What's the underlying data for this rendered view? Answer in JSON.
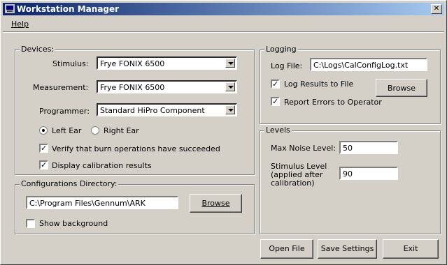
{
  "window": {
    "title": "Workstation Manager",
    "close_glyph": "✕"
  },
  "menu": {
    "help": "Help"
  },
  "devices": {
    "legend": "Devices:",
    "stimulus_label": "Stimulus:",
    "stimulus_value": "Frye FONIX 6500",
    "measurement_label": "Measurement:",
    "measurement_value": "Frye FONIX 6500",
    "programmer_label": "Programmer:",
    "programmer_value": "Standard HiPro Component",
    "left_ear": "Left Ear",
    "right_ear": "Right Ear",
    "selected_ear": "left",
    "verify_label": "Verify that burn operations have succeeded",
    "verify_checked": true,
    "display_label": "Display calibration results",
    "display_checked": true
  },
  "config_dir": {
    "legend": "Configurations Directory:",
    "path": "C:\\Program Files\\Gennum\\ARK",
    "browse": "Browse",
    "show_background": "Show background",
    "show_background_checked": false
  },
  "logging": {
    "legend": "Logging",
    "log_file_label": "Log File:",
    "log_file_value": "C:\\Logs\\CalConfigLog.txt",
    "log_results": "Log Results to File",
    "log_results_checked": true,
    "report_errors": "Report Errors to Operator",
    "report_errors_checked": true,
    "browse": "Browse"
  },
  "levels": {
    "legend": "Levels",
    "max_noise_label": "Max Noise Level:",
    "max_noise_value": "50",
    "stimulus_label_1": "Stimulus Level",
    "stimulus_label_2": "(applied after",
    "stimulus_label_3": "calibration)",
    "stimulus_value": "90"
  },
  "buttons": {
    "open_file": "Open File",
    "save_settings": "Save Settings",
    "exit": "Exit"
  },
  "colors": {
    "titlebar_start": "#0a246a",
    "titlebar_end": "#a6caf0",
    "face": "#d4d0c8"
  }
}
